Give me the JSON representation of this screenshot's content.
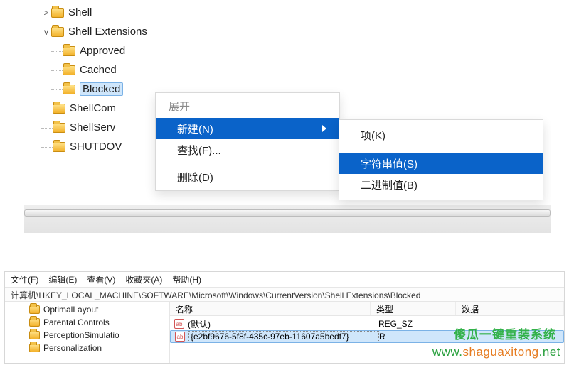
{
  "tree": {
    "shell": "Shell",
    "shellExtensions": "Shell Extensions",
    "approved": "Approved",
    "cached": "Cached",
    "blocked": "Blocked",
    "shellCom": "ShellCom",
    "shellServ": "ShellServ",
    "shutdov": "SHUTDOV"
  },
  "contextMenu": {
    "expand": "展开",
    "new": "新建(N)",
    "find": "查找(F)...",
    "delete": "删除(D)"
  },
  "submenu": {
    "key": "项(K)",
    "string": "字符串值(S)",
    "binary": "二进制值(B)"
  },
  "lower": {
    "menu": {
      "file": "文件(F)",
      "edit": "编辑(E)",
      "view": "查看(V)",
      "fav": "收藏夹(A)",
      "help": "帮助(H)"
    },
    "address": "计算机\\HKEY_LOCAL_MACHINE\\SOFTWARE\\Microsoft\\Windows\\CurrentVersion\\Shell Extensions\\Blocked",
    "tree": {
      "optimalLayout": "OptimalLayout",
      "parentalControls": "Parental Controls",
      "perception": "PerceptionSimulatio",
      "personalization": "Personalization"
    },
    "columns": {
      "name": "名称",
      "type": "类型",
      "data": "数据"
    },
    "rows": {
      "default": "(默认)",
      "guid": "{e2bf9676-5f8f-435c-97eb-11607a5bedf7}",
      "defaultType": "REG_SZ",
      "guidType": "R"
    }
  },
  "watermark": {
    "title": "傻瓜一键重装系统",
    "url_pre": "www.",
    "url_main": "shaguaxitong",
    "url_suf": ".net"
  }
}
